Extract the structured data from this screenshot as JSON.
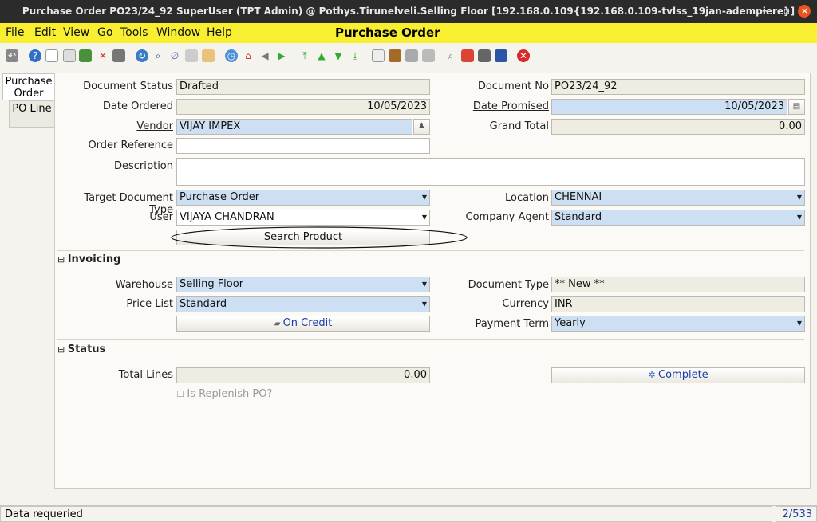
{
  "window": {
    "title": "Purchase Order  PO23/24_92  SuperUser (TPT Admin) @ Pothys.Tirunelveli.Selling Floor [192.168.0.109{192.168.0.109-tvlss_19jan-adempiere}]",
    "minimize": "–",
    "restore": "▫",
    "close": "×"
  },
  "menu": {
    "file": "File",
    "edit": "Edit",
    "view": "View",
    "go": "Go",
    "tools": "Tools",
    "window": "Window",
    "help": "Help",
    "window_title": "Purchase Order"
  },
  "tabs": {
    "order": "Purchase Order",
    "line": "PO Line"
  },
  "form": {
    "document_status": {
      "label": "Document Status",
      "value": "Drafted"
    },
    "document_no": {
      "label": "Document No",
      "value": "PO23/24_92"
    },
    "date_ordered": {
      "label": "Date Ordered",
      "value": "10/05/2023"
    },
    "date_promised": {
      "label": "Date Promised",
      "value": "10/05/2023"
    },
    "vendor": {
      "label": "Vendor",
      "value": "VIJAY IMPEX"
    },
    "grand_total": {
      "label": "Grand Total",
      "value": "0.00"
    },
    "order_reference": {
      "label": "Order Reference",
      "value": ""
    },
    "description": {
      "label": "Description",
      "value": ""
    },
    "target_doc_type": {
      "label": "Target Document Type",
      "value": "Purchase Order"
    },
    "location": {
      "label": "Location",
      "value": "CHENNAI"
    },
    "user": {
      "label": "User",
      "value": "VIJAYA CHANDRAN"
    },
    "company_agent": {
      "label": "Company Agent",
      "value": "Standard"
    },
    "search_product": "Search Product"
  },
  "invoicing": {
    "title": "Invoicing",
    "warehouse": {
      "label": "Warehouse",
      "value": "Selling Floor"
    },
    "document_type": {
      "label": "Document Type",
      "value": "** New **"
    },
    "price_list": {
      "label": "Price List",
      "value": "Standard"
    },
    "currency": {
      "label": "Currency",
      "value": "INR"
    },
    "on_credit": "On Credit",
    "payment_term": {
      "label": "Payment Term",
      "value": "Yearly"
    }
  },
  "status": {
    "title": "Status",
    "total_lines": {
      "label": "Total Lines",
      "value": "0.00"
    },
    "complete": "Complete",
    "is_replenish": "Is Replenish PO?"
  },
  "statusbar": {
    "message": "Data requeried",
    "count": "2/533"
  },
  "colors": {
    "menubar": "#f7ef2f",
    "mandatory": "#cde0f3",
    "readonly": "#efece2",
    "link": "#1a3ea8"
  }
}
